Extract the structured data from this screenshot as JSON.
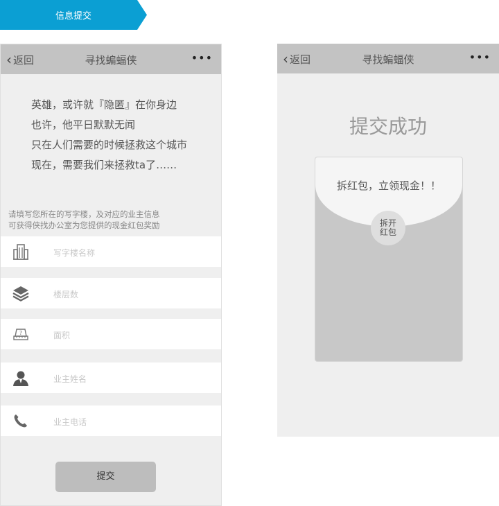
{
  "banner": {
    "label": "信息提交"
  },
  "screen1": {
    "nav": {
      "back": "返回",
      "title": "寻找蝙蝠侠",
      "more": "•••"
    },
    "poem": [
      "英雄，或许就『隐匿』在你身边",
      "也许，他平日默默无闻",
      "只在人们需要的时候拯救这个城市",
      "现在，需要我们来拯救ta了……"
    ],
    "hint": [
      "请填写您所在的写字楼，及对应的业主信息",
      "可获得侠找办公室为您提供的现金红包奖励"
    ],
    "fields": [
      {
        "icon": "building-icon",
        "placeholder": "写字楼名称"
      },
      {
        "icon": "layers-icon",
        "placeholder": "楼层数"
      },
      {
        "icon": "area-icon",
        "placeholder": "面积"
      },
      {
        "icon": "person-icon",
        "placeholder": "业主姓名"
      },
      {
        "icon": "phone-icon",
        "placeholder": "业主电话"
      }
    ],
    "submit": "提交"
  },
  "screen2": {
    "nav": {
      "back": "返回",
      "title": "寻找蝙蝠侠",
      "more": "•••"
    },
    "success": "提交成功",
    "envelope_text": "拆红包，立领现金！！",
    "open_line1": "拆开",
    "open_line2": "红包"
  }
}
